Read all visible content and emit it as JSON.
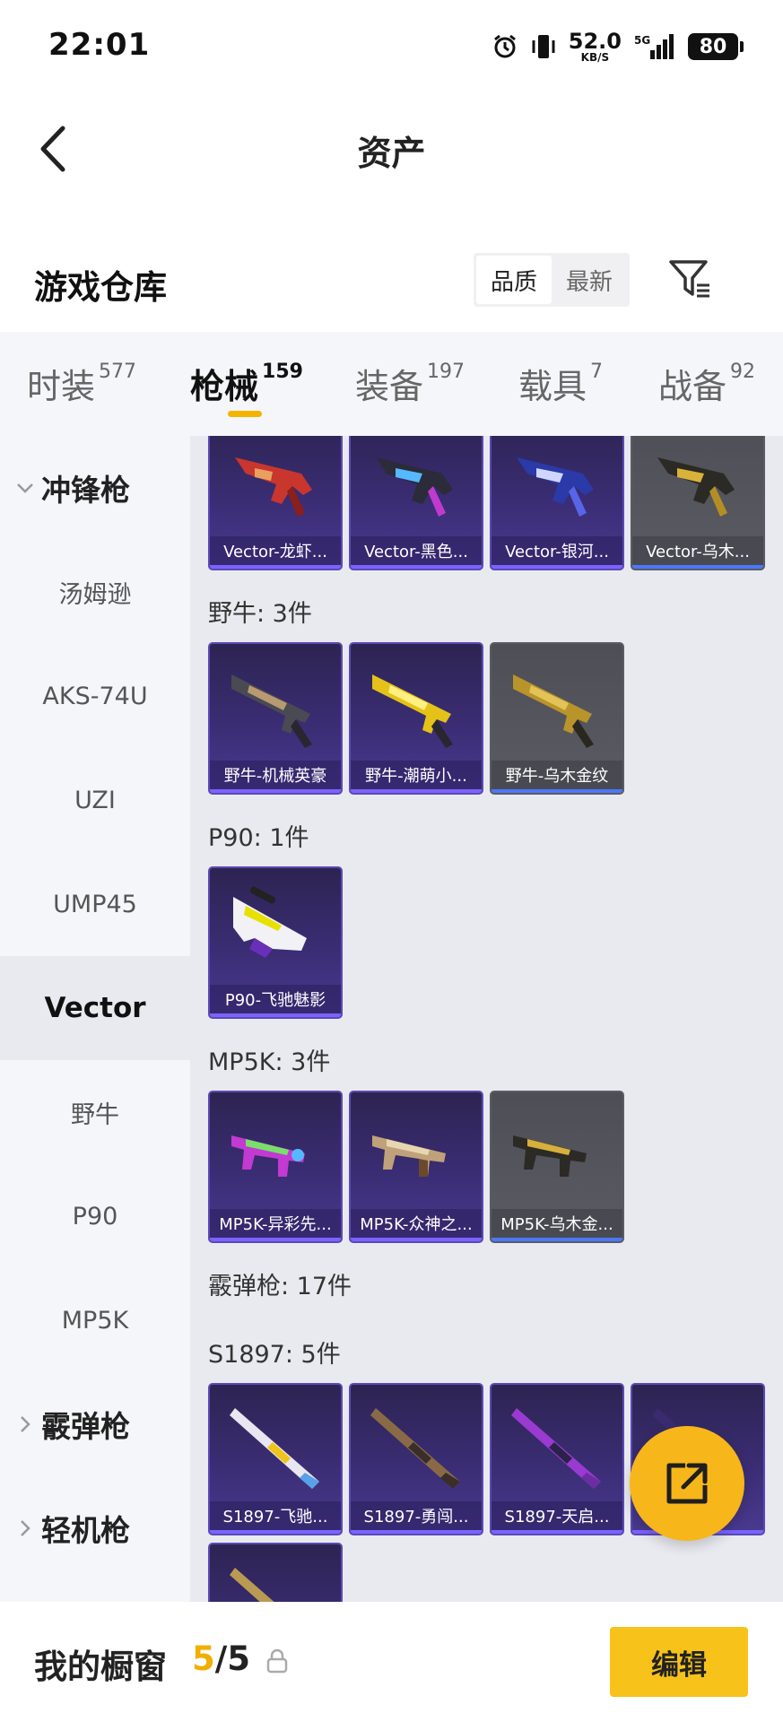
{
  "status_bar": {
    "time": "22:01",
    "net_speed": "52.0",
    "net_unit": "KB/S",
    "signal": "5G",
    "battery": "80",
    "icons": [
      "alarm-icon",
      "vibrate-icon",
      "signal-icon"
    ]
  },
  "nav": {
    "title": "资产",
    "back_icon": "chevron-left-icon"
  },
  "header": {
    "title": "游戏仓库",
    "sort_options": [
      "品质",
      "最新"
    ],
    "sort_selected": "品质",
    "filter_icon": "filter-icon"
  },
  "tabs": [
    {
      "label": "时装",
      "count": "577"
    },
    {
      "label": "枪械",
      "count": "159",
      "active": true
    },
    {
      "label": "装备",
      "count": "197"
    },
    {
      "label": "载具",
      "count": "7"
    },
    {
      "label": "战备",
      "count": "92"
    }
  ],
  "side_menu": {
    "group_open": "冲锋枪",
    "items": [
      "汤姆逊",
      "AKS-74U",
      "UZI",
      "UMP45",
      "Vector",
      "野牛",
      "P90",
      "MP5K"
    ],
    "active_item": "Vector",
    "group_shotgun": "霰弹枪",
    "group_lmg": "轻机枪"
  },
  "content": {
    "vector_cards": [
      "Vector-龙虾...",
      "Vector-黑色...",
      "Vector-银河...",
      "Vector-乌木..."
    ],
    "bizon_label": "野牛: 3件",
    "bizon_cards": [
      "野牛-机械英豪",
      "野牛-潮萌小...",
      "野牛-乌木金纹"
    ],
    "p90_label": "P90: 1件",
    "p90_cards": [
      "P90-飞驰魅影"
    ],
    "mp5k_label": "MP5K: 3件",
    "mp5k_cards": [
      "MP5K-异彩先...",
      "MP5K-众神之...",
      "MP5K-乌木金..."
    ],
    "shotgun_label": "霰弹枪: 17件",
    "s1897_label": "S1897: 5件",
    "s1897_cards": [
      "S1897-飞驰...",
      "S1897-勇闯...",
      "S1897-天启..."
    ]
  },
  "fab": {
    "icon": "share-external-icon"
  },
  "bottom": {
    "label": "我的橱窗",
    "current": "5",
    "separator": "/",
    "total": "5",
    "lock_icon": "lock-icon",
    "edit_label": "编辑"
  },
  "colors": {
    "accent": "#f7c21a",
    "card_purple": "#3a2d74",
    "card_gray": "#5b5b63"
  }
}
